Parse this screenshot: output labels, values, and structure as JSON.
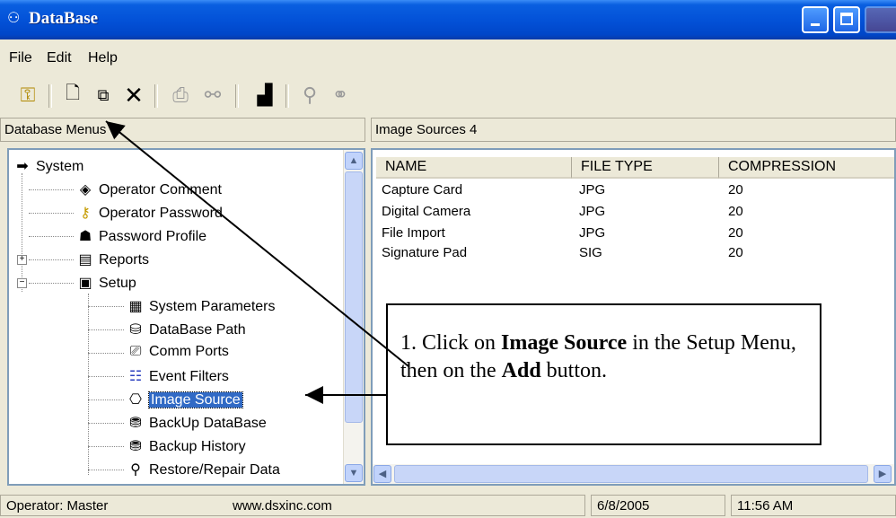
{
  "window": {
    "title": "DataBase"
  },
  "menu": [
    {
      "label": "File",
      "underline": "F"
    },
    {
      "label": "Edit",
      "underline": "E"
    },
    {
      "label": "Help",
      "underline": "H"
    }
  ],
  "panes": {
    "left_header": "Database Menus",
    "right_header": "Image Sources   4"
  },
  "tree": [
    {
      "label": "System",
      "icon": "arrow-right-icon"
    },
    {
      "label": "Operator Comment",
      "icon": "comment-icon"
    },
    {
      "label": "Operator Password",
      "icon": "key-icon"
    },
    {
      "label": "Password Profile",
      "icon": "profile-icon"
    },
    {
      "label": "Reports",
      "icon": "report-icon"
    },
    {
      "label": "Setup",
      "icon": "computer-icon"
    },
    {
      "label": "System Parameters",
      "icon": "parameters-icon"
    },
    {
      "label": "DataBase Path",
      "icon": "path-icon"
    },
    {
      "label": "Comm Ports",
      "icon": "comm-icon"
    },
    {
      "label": "Event Filters",
      "icon": "filter-icon"
    },
    {
      "label": "Image Source",
      "icon": "camera-icon",
      "selected": true
    },
    {
      "label": "BackUp DataBase",
      "icon": "backup-icon"
    },
    {
      "label": "Backup History",
      "icon": "history-icon"
    },
    {
      "label": "Restore/Repair Data",
      "icon": "repair-icon"
    }
  ],
  "table": {
    "columns": [
      "NAME",
      "FILE TYPE",
      "COMPRESSION"
    ],
    "rows": [
      [
        "Capture Card",
        "JPG",
        "20"
      ],
      [
        "Digital Camera",
        "JPG",
        "20"
      ],
      [
        "File Import",
        "JPG",
        "20"
      ],
      [
        "Signature Pad",
        "SIG",
        "20"
      ]
    ]
  },
  "callout": {
    "num": "1. Click on ",
    "bold1": "Image Source",
    "mid": " in the Setup Menu, then on the ",
    "bold2": "Add",
    "end": " button."
  },
  "status": {
    "operator": "Operator:  Master",
    "url": "www.dsxinc.com",
    "date": "6/8/2005",
    "time": "11:56 AM"
  }
}
